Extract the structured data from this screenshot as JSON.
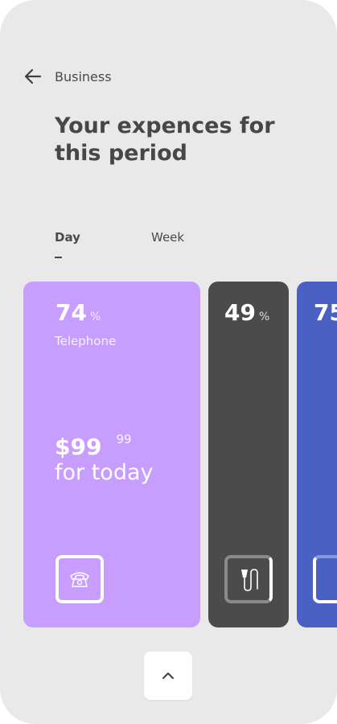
{
  "header": {
    "title": "Business"
  },
  "page": {
    "title": "Your expences for this period"
  },
  "tabs": [
    {
      "label": "Day",
      "active": true
    },
    {
      "label": "Week",
      "active": false
    }
  ],
  "cards": [
    {
      "percent": "74",
      "percent_unit": "%",
      "category": "Telephone",
      "amount": "$99",
      "cents": "99",
      "period": "for today",
      "color": "#c79dff",
      "icon": "telephone-icon",
      "progress": 0.74
    },
    {
      "percent": "49",
      "percent_unit": "%",
      "color": "#4b4b4b",
      "icon": "cable-plug-icon",
      "progress": 0.49
    },
    {
      "percent": "75",
      "color": "#4a61c3",
      "progress": 0.75
    }
  ]
}
